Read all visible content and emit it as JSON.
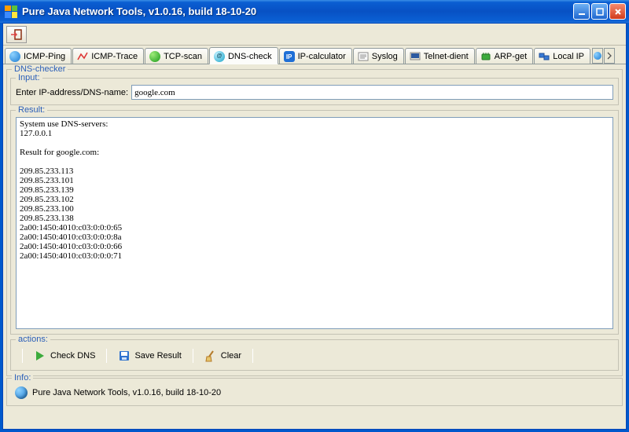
{
  "window": {
    "title": "Pure Java Network Tools,  v1.0.16, build 18-10-20"
  },
  "tabs": [
    {
      "id": "icmp-ping",
      "label": "ICMP-Ping",
      "active": false
    },
    {
      "id": "icmp-trace",
      "label": "ICMP-Trace",
      "active": false
    },
    {
      "id": "tcp-scan",
      "label": "TCP-scan",
      "active": false
    },
    {
      "id": "dns-check",
      "label": "DNS-check",
      "active": true
    },
    {
      "id": "ip-calculator",
      "label": "IP-calculator",
      "active": false
    },
    {
      "id": "syslog",
      "label": "Syslog",
      "active": false
    },
    {
      "id": "telnet-client",
      "label": "Telnet-dient",
      "active": false
    },
    {
      "id": "arp-get",
      "label": "ARP-get",
      "active": false
    },
    {
      "id": "local-ip",
      "label": "Local IP",
      "active": false
    }
  ],
  "panel": {
    "group_title": "DNS-checker",
    "input_group": "Input:",
    "input_label": "Enter IP-address/DNS-name:",
    "input_value": "google.com",
    "result_group": "Result:",
    "result_text": "System use DNS-servers:\n127.0.0.1\n\nResult for google.com:\n\n209.85.233.113\n209.85.233.101\n209.85.233.139\n209.85.233.102\n209.85.233.100\n209.85.233.138\n2a00:1450:4010:c03:0:0:0:65\n2a00:1450:4010:c03:0:0:0:8a\n2a00:1450:4010:c03:0:0:0:66\n2a00:1450:4010:c03:0:0:0:71",
    "actions_group": "actions:",
    "actions": {
      "check": "Check DNS",
      "save": "Save Result",
      "clear": "Clear"
    },
    "info_group": "Info:",
    "info_text": "Pure Java Network Tools,  v1.0.16, build 18-10-20"
  },
  "colors": {
    "titlebar_start": "#3b8fe6",
    "titlebar_end": "#0851c4",
    "panel_bg": "#ece9d8",
    "border": "#919b9c",
    "field_border": "#7f9db9"
  }
}
